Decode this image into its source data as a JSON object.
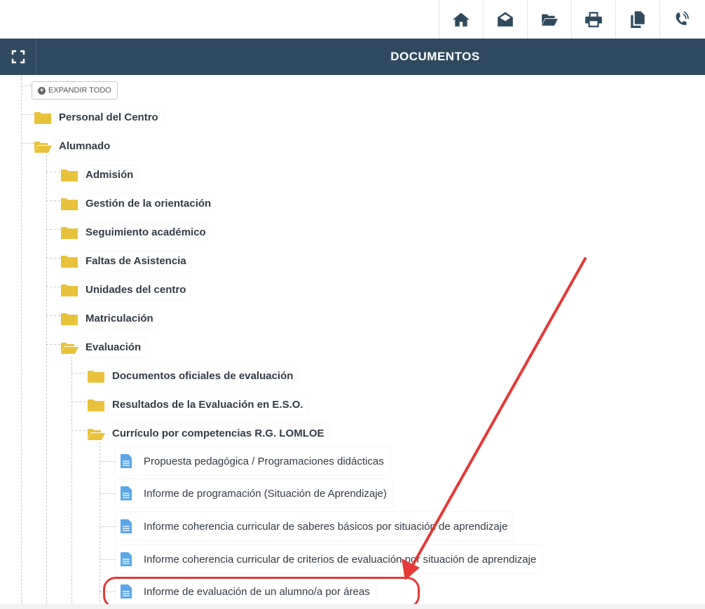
{
  "header": {
    "title": "DOCUMENTOS"
  },
  "toolbar": {
    "icons": [
      "home-icon",
      "envelope-open-icon",
      "folder-open-icon",
      "print-icon",
      "copy-icon",
      "phone-volume-icon"
    ]
  },
  "tree": {
    "expand_all_label": "EXPANDIR TODO",
    "personal": "Personal del Centro",
    "alumnado": "Alumnado",
    "alumnado_children": {
      "admision": "Admisión",
      "orientacion": "Gestión de la orientación",
      "seguimiento": "Seguimiento académico",
      "faltas": "Faltas de Asistencia",
      "unidades": "Unidades del centro",
      "matriculacion": "Matriculación",
      "evaluacion": "Evaluación"
    },
    "evaluacion_children": {
      "documentos_oficiales": "Documentos oficiales de evaluación",
      "resultados_eso": "Resultados de la Evaluación en E.S.O.",
      "curriculo": "Currículo por competencias R.G. LOMLOE"
    },
    "curriculo_docs": [
      "Propuesta pedagógica / Programaciones didácticas",
      "Informe de programación (Situación de Aprendizaje)",
      "Informe coherencia curricular de saberes básicos por situación de aprendizaje",
      "Informe coherencia curricular de criterios de evaluación por situación de aprendizaje",
      "Informe de evaluación de un alumno/a por áreas"
    ]
  },
  "colors": {
    "header_bg": "#2f4a60",
    "folder": "#e8c23a",
    "doc_icon": "#5aa6e6",
    "annotation": "#e53935"
  }
}
